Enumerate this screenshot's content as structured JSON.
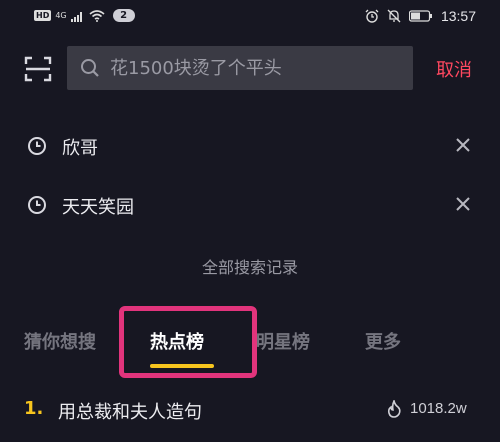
{
  "status_bar": {
    "hd": "HD",
    "network": "4G",
    "notification_count": "2",
    "time": "13:57"
  },
  "search": {
    "placeholder": "花1500块烫了个平头",
    "cancel_label": "取消"
  },
  "history": {
    "items": [
      {
        "label": "欣哥"
      },
      {
        "label": "天天笑园"
      }
    ],
    "all_label": "全部搜索记录"
  },
  "tabs": [
    {
      "label": "猜你想搜",
      "active": false
    },
    {
      "label": "热点榜",
      "active": true
    },
    {
      "label": "明星榜",
      "active": false
    },
    {
      "label": "更多",
      "active": false
    }
  ],
  "hot_list": [
    {
      "rank": "1.",
      "title": "用总裁和夫人造句",
      "count": "1018.2w"
    }
  ],
  "colors": {
    "background": "#171722",
    "accent_red": "#ff4860",
    "accent_yellow": "#f7c51e",
    "highlight_box": "#e2347c"
  },
  "icons": {
    "scan": "scan-icon",
    "search": "search-icon",
    "history": "clock-icon",
    "delete": "close-icon",
    "hot": "flame-icon"
  }
}
